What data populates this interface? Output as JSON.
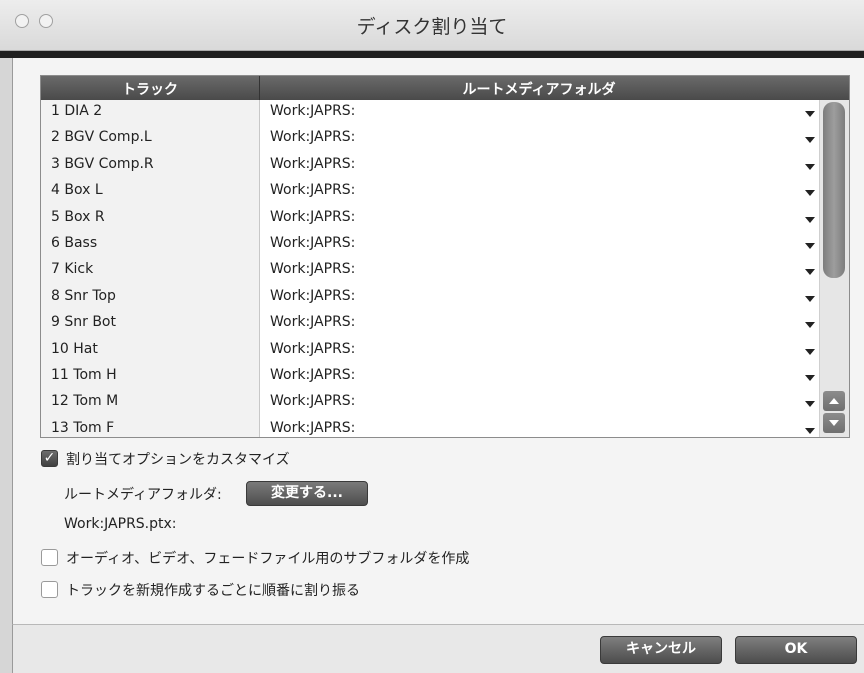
{
  "window": {
    "title": "ディスク割り当て"
  },
  "table": {
    "headers": [
      "トラック",
      "ルートメディアフォルダ"
    ],
    "rows": [
      {
        "track": "1 DIA 2",
        "folder": "Work:JAPRS:"
      },
      {
        "track": "2 BGV Comp.L",
        "folder": "Work:JAPRS:"
      },
      {
        "track": "3 BGV Comp.R",
        "folder": "Work:JAPRS:"
      },
      {
        "track": "4 Box L",
        "folder": "Work:JAPRS:"
      },
      {
        "track": "5 Box R",
        "folder": "Work:JAPRS:"
      },
      {
        "track": "6 Bass",
        "folder": "Work:JAPRS:"
      },
      {
        "track": "7 Kick",
        "folder": "Work:JAPRS:"
      },
      {
        "track": "8 Snr Top",
        "folder": "Work:JAPRS:"
      },
      {
        "track": "9 Snr Bot",
        "folder": "Work:JAPRS:"
      },
      {
        "track": "10 Hat",
        "folder": "Work:JAPRS:"
      },
      {
        "track": "11 Tom H",
        "folder": "Work:JAPRS:"
      },
      {
        "track": "12 Tom M",
        "folder": "Work:JAPRS:"
      },
      {
        "track": "13 Tom F",
        "folder": "Work:JAPRS:"
      }
    ]
  },
  "options": {
    "customize_label": "割り当てオプションをカスタマイズ",
    "customize_checked": true,
    "root_folder_label": "ルートメディアフォルダ:",
    "change_button": "変更する...",
    "path": "Work:JAPRS.ptx:",
    "subfolder_label": "オーディオ、ビデオ、フェードファイル用のサブフォルダを作成",
    "subfolder_checked": false,
    "roundrobin_label": "トラックを新規作成するごとに順番に割り振る",
    "roundrobin_checked": false
  },
  "footer": {
    "cancel": "キャンセル",
    "ok": "OK"
  }
}
